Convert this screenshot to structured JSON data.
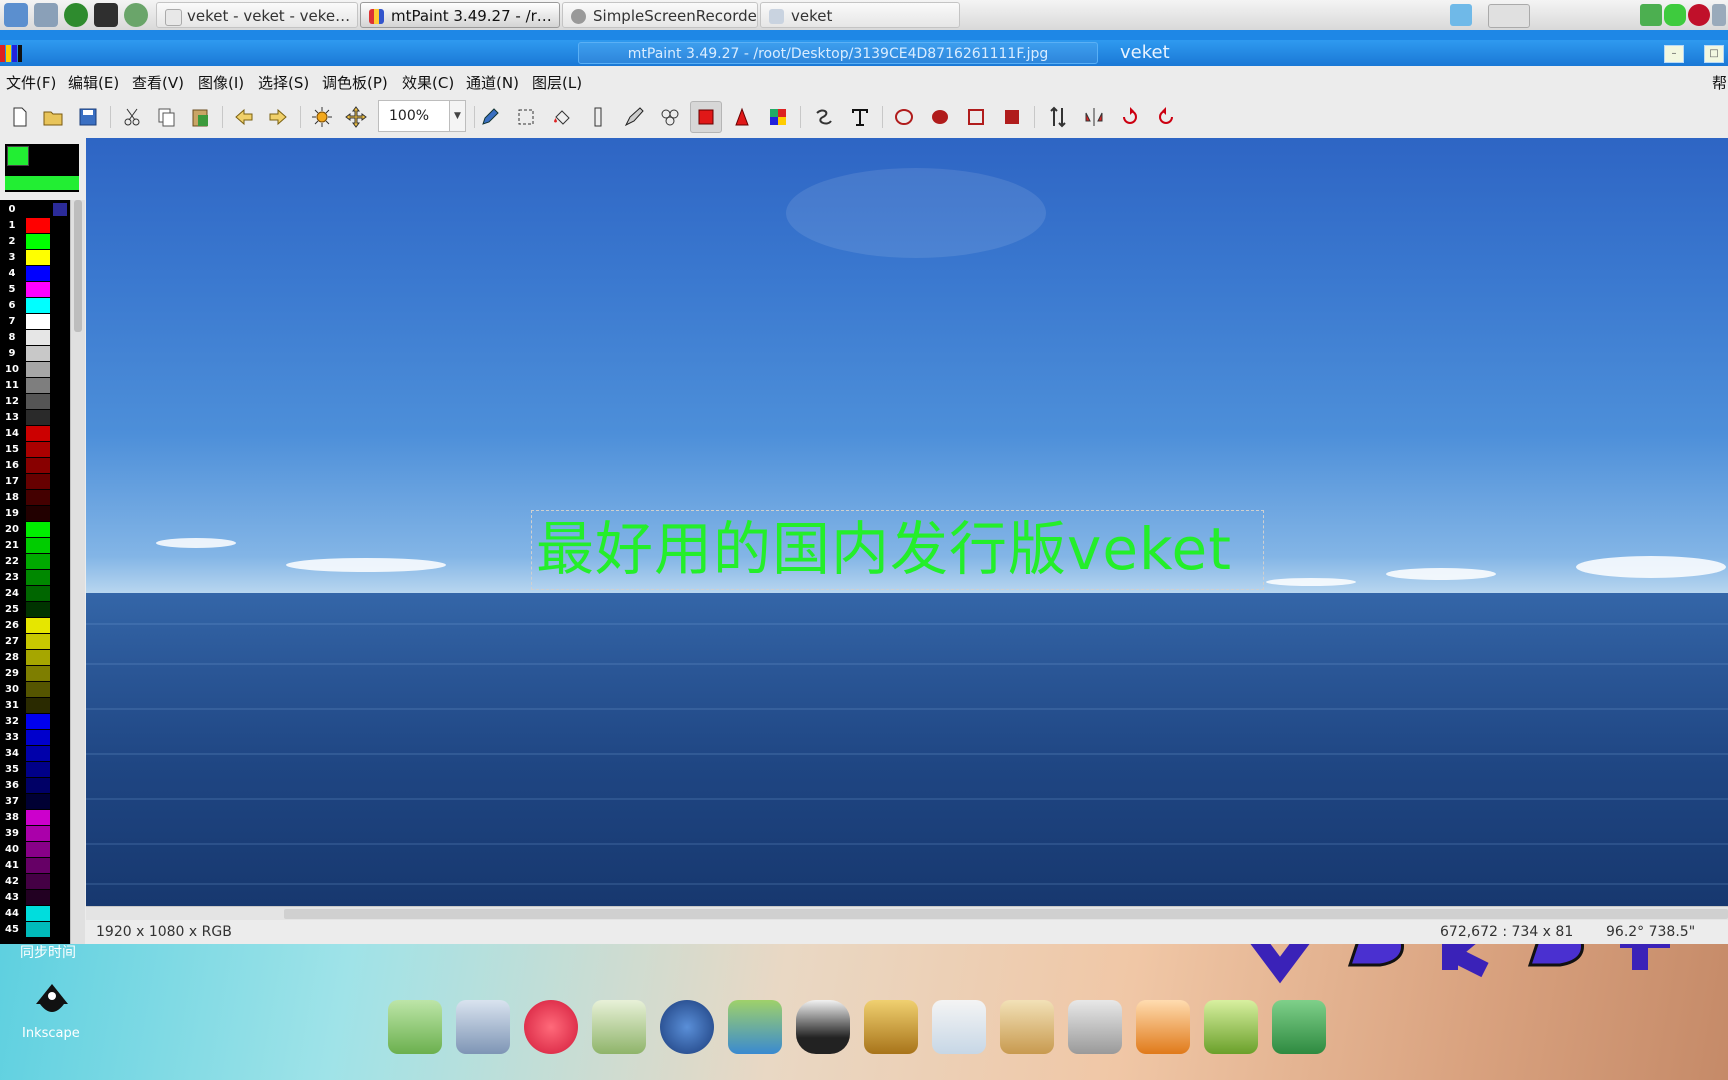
{
  "taskbar": {
    "tasks": [
      {
        "label": "veket - veket - veke…"
      },
      {
        "label": "mtPaint 3.49.27 - /r…"
      },
      {
        "label": "SimpleScreenRecorder"
      },
      {
        "label": "veket"
      }
    ]
  },
  "window": {
    "title": "mtPaint 3.49.27 - /root/Desktop/3139CE4D8716261111F.jpg",
    "title_right": "veket"
  },
  "menubar": {
    "items": [
      "文件(F)",
      "编辑(E)",
      "查看(V)",
      "图像(I)",
      "选择(S)",
      "调色板(P)",
      "效果(C)",
      "通道(N)",
      "图层(L)"
    ],
    "help": "帮"
  },
  "toolbar": {
    "zoom_value": "100%",
    "tools": [
      "new-icon",
      "open-icon",
      "save-icon",
      "cut-icon",
      "copy-icon",
      "paste-icon",
      "undo-icon",
      "redo-icon",
      "brightness-icon",
      "pan-icon",
      "pencil-icon",
      "select-icon",
      "flood-fill-icon",
      "line-icon",
      "brush-icon",
      "clone-icon",
      "rect-select-icon",
      "lasso-icon",
      "palette-editor-icon",
      "smudge-icon",
      "text-icon",
      "ellipse-outline-icon",
      "ellipse-fill-icon",
      "rect-outline-icon",
      "rect-fill-icon",
      "flip-v-icon",
      "flip-h-icon",
      "rotate-cw-icon",
      "rotate-ccw-icon"
    ]
  },
  "palette": {
    "foreground": "#22ee33",
    "entries": [
      {
        "n": "0",
        "c": "#000000"
      },
      {
        "n": "1",
        "c": "#ff0000"
      },
      {
        "n": "2",
        "c": "#00ff00"
      },
      {
        "n": "3",
        "c": "#ffff00"
      },
      {
        "n": "4",
        "c": "#0000ff"
      },
      {
        "n": "5",
        "c": "#ff00ff"
      },
      {
        "n": "6",
        "c": "#00ffff"
      },
      {
        "n": "7",
        "c": "#ffffff"
      },
      {
        "n": "8",
        "c": "#e6e6e6"
      },
      {
        "n": "9",
        "c": "#c8c8c8"
      },
      {
        "n": "10",
        "c": "#a6a6a6"
      },
      {
        "n": "11",
        "c": "#7e7e7e"
      },
      {
        "n": "12",
        "c": "#555555"
      },
      {
        "n": "13",
        "c": "#2a2a2a"
      },
      {
        "n": "14",
        "c": "#cc0000"
      },
      {
        "n": "15",
        "c": "#aa0000"
      },
      {
        "n": "16",
        "c": "#880000"
      },
      {
        "n": "17",
        "c": "#660000"
      },
      {
        "n": "18",
        "c": "#440000"
      },
      {
        "n": "19",
        "c": "#220000"
      },
      {
        "n": "20",
        "c": "#00ee00"
      },
      {
        "n": "21",
        "c": "#00cc00"
      },
      {
        "n": "22",
        "c": "#00aa00"
      },
      {
        "n": "23",
        "c": "#008800"
      },
      {
        "n": "24",
        "c": "#006600"
      },
      {
        "n": "25",
        "c": "#003300"
      },
      {
        "n": "26",
        "c": "#e6e600"
      },
      {
        "n": "27",
        "c": "#c8c800"
      },
      {
        "n": "28",
        "c": "#a6a600"
      },
      {
        "n": "29",
        "c": "#7e7e00"
      },
      {
        "n": "30",
        "c": "#555500"
      },
      {
        "n": "31",
        "c": "#2a2a00"
      },
      {
        "n": "32",
        "c": "#0000ee"
      },
      {
        "n": "33",
        "c": "#0000cc"
      },
      {
        "n": "34",
        "c": "#0000aa"
      },
      {
        "n": "35",
        "c": "#000088"
      },
      {
        "n": "36",
        "c": "#000066"
      },
      {
        "n": "37",
        "c": "#000033"
      },
      {
        "n": "38",
        "c": "#cc00cc"
      },
      {
        "n": "39",
        "c": "#aa00aa"
      },
      {
        "n": "40",
        "c": "#880088"
      },
      {
        "n": "41",
        "c": "#660066"
      },
      {
        "n": "42",
        "c": "#440044"
      },
      {
        "n": "43",
        "c": "#220022"
      },
      {
        "n": "44",
        "c": "#00dddd"
      },
      {
        "n": "45",
        "c": "#00bbbb"
      }
    ]
  },
  "canvas": {
    "text": "最好用的国内发行版veket",
    "text_color": "#24ee2a"
  },
  "status": {
    "image_info": "1920 x 1080 x RGB",
    "selection": "672,672 : 734 x 81",
    "pointer": "96.2° 738.5\""
  },
  "desktop": {
    "label": "同步时间",
    "inkscape_label": "Inkscape",
    "dock_icons": [
      "file-manager-icon",
      "computer-icon",
      "hedgehog-icon",
      "editor-icon",
      "media-player-icon",
      "users-icon",
      "penguin-icon",
      "notebook-icon",
      "presentation-icon",
      "paint-icon",
      "usb-icon",
      "veket-mascot-icon",
      "help-icon",
      "camera-icon"
    ]
  }
}
